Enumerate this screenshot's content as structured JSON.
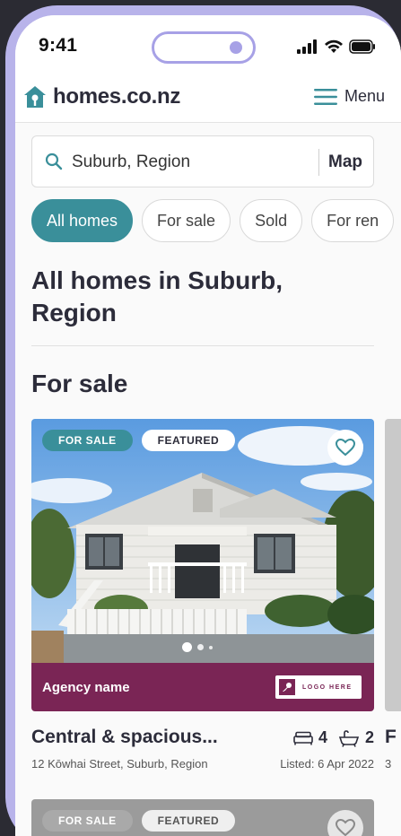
{
  "status_bar": {
    "time": "9:41"
  },
  "header": {
    "logo_text": "homes.co.nz",
    "menu_label": "Menu"
  },
  "search": {
    "value": "Suburb, Region",
    "map_label": "Map"
  },
  "filters": [
    "All homes",
    "For sale",
    "Sold",
    "For ren"
  ],
  "page_title": "All homes in Suburb, Region",
  "section_title": "For sale",
  "listing": {
    "badge_sale": "FOR SALE",
    "badge_featured": "FEATURED",
    "agency_name": "Agency name",
    "agency_logo": "LOGO HERE",
    "title": "Central & spacious...",
    "bedrooms": "4",
    "bathrooms": "2",
    "address": "12 Kōwhai Street, Suburb, Region",
    "listed": "Listed: 6 Apr 2022"
  },
  "peek": {
    "title_fragment": "F",
    "address_fragment": "3"
  },
  "listing2": {
    "badge_sale": "FOR SALE",
    "badge_featured": "FEATURED"
  },
  "colors": {
    "teal": "#3a8f9a",
    "agency": "#7a2555",
    "frame": "#b8b3ea"
  }
}
